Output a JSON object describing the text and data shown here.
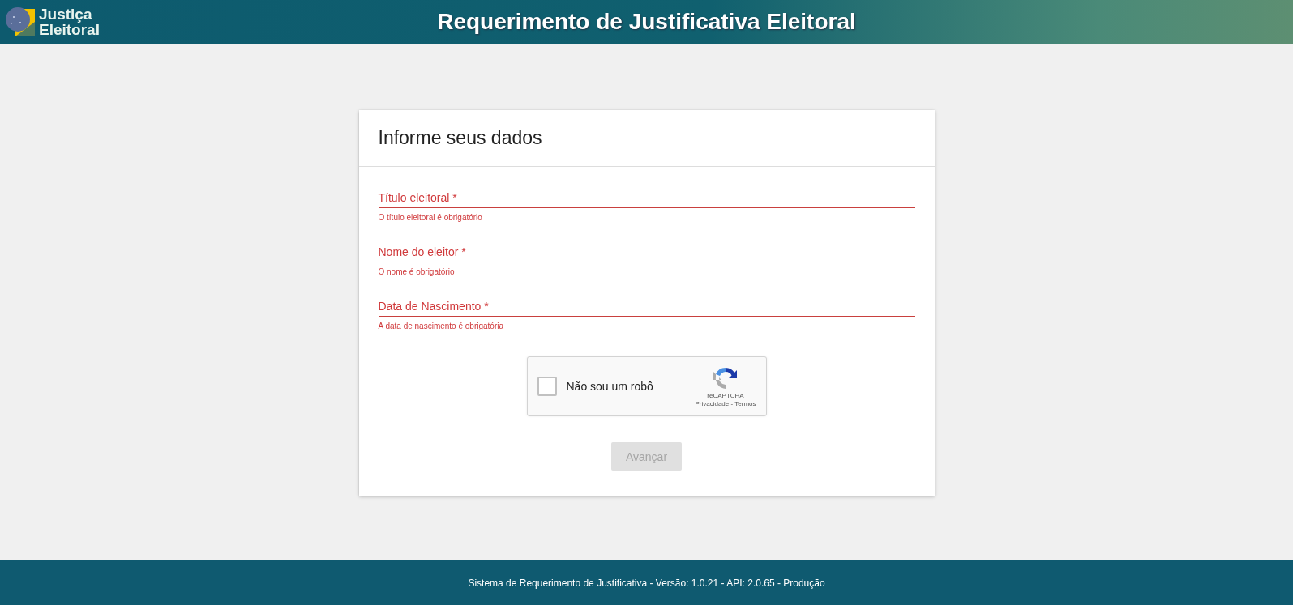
{
  "header": {
    "logo_text": [
      "Justiça",
      "Eleitoral"
    ],
    "title": "Requerimento de Justificativa Eleitoral"
  },
  "form": {
    "title": "Informe seus dados",
    "fields": [
      {
        "label": "Título eleitoral *",
        "error": true,
        "helper": "O título eleitoral é obrigatório"
      },
      {
        "label": "Nome do eleitor *",
        "error": true,
        "helper": "O nome é obrigatório"
      },
      {
        "label": "Data de Nascimento *",
        "error": true,
        "helper": "A data de nascimento é obrigatória"
      }
    ],
    "captcha": {
      "label": "Não sou um robô",
      "checked": false,
      "brand": "reCAPTCHA",
      "privacy": "Privacidade",
      "separator": "-",
      "terms": "Termos"
    },
    "submit": {
      "label": "Avançar",
      "disabled": true
    }
  },
  "footer": {
    "text": "Sistema de Requerimento de Justificativa - Versão: 1.0.21 - API: 2.0.65 - Produção"
  }
}
